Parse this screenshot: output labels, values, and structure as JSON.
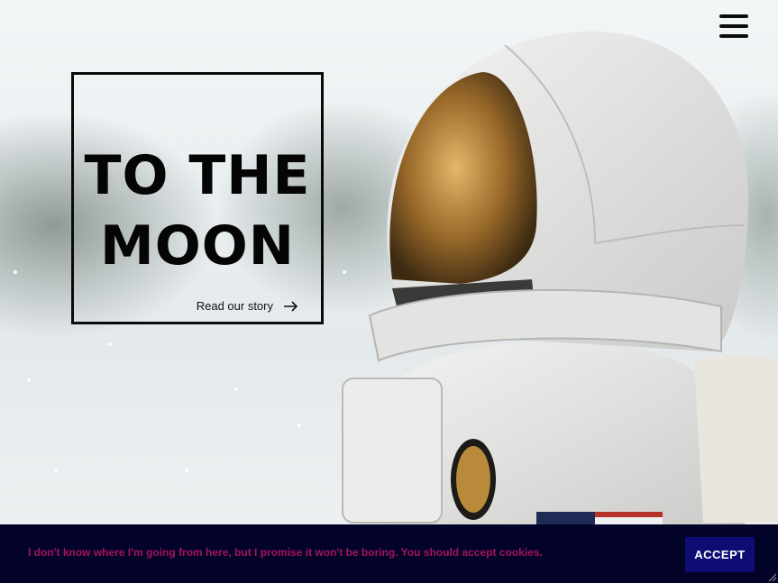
{
  "hero": {
    "title_line_1": "TO THE",
    "title_line_2": "MOON",
    "story_link_label": "Read our story",
    "story_link_icon": "arrow-right-icon",
    "menu_icon": "hamburger-menu-icon"
  },
  "cookie_banner": {
    "message": "I don't know where I'm going from here, but I promise it won't be boring. You should accept cookies.",
    "accept_label": "ACCEPT"
  },
  "colors": {
    "cookie_background": "#03032a",
    "cookie_text": "#a3145a",
    "accept_button": "#0d0d73",
    "title_text": "#050505"
  }
}
